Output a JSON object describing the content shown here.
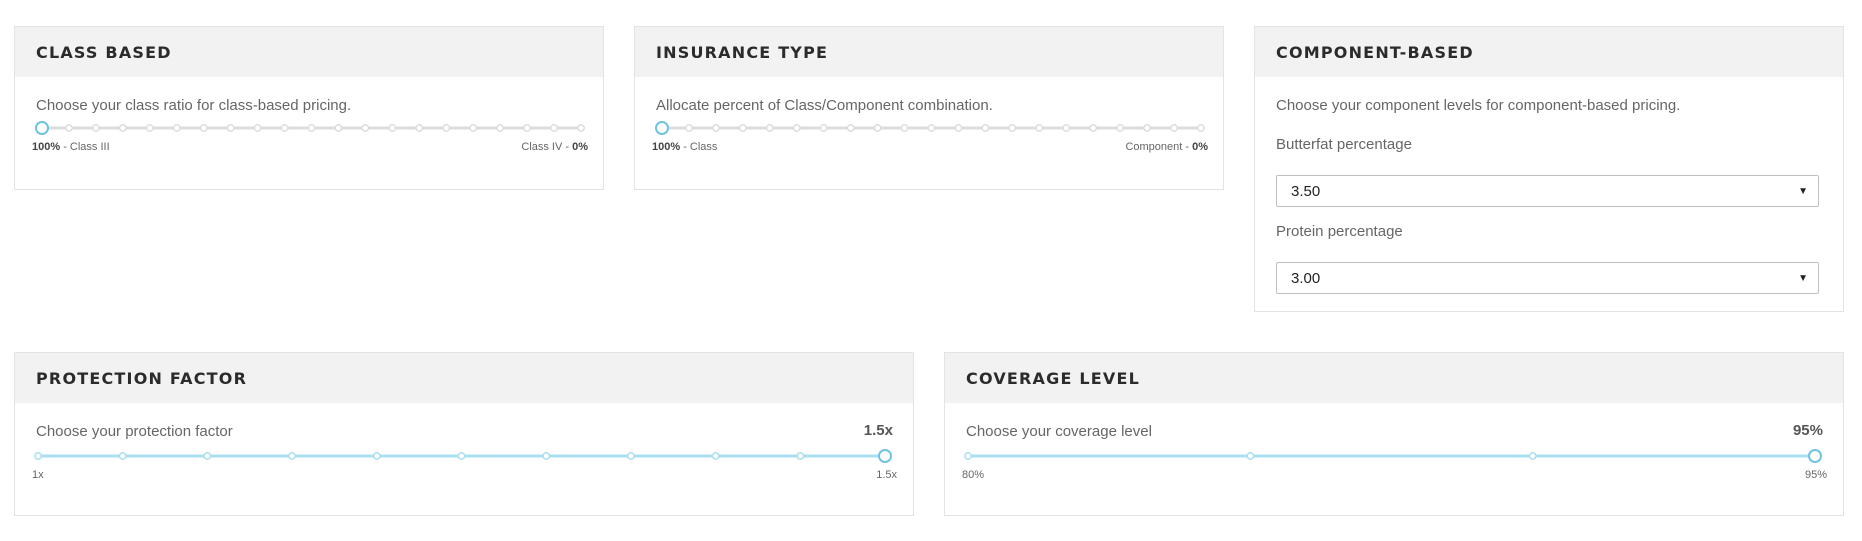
{
  "colors": {
    "track_inactive": "#dcdcdc",
    "track_active": "#a9dff0",
    "handle_border": "#6fc3e0"
  },
  "class_based": {
    "title": "CLASS BASED",
    "description": "Choose your class ratio for class-based pricing.",
    "slider": {
      "left_label_bold": "100%",
      "left_label_rest": " - Class III",
      "right_label_rest": "Class IV - ",
      "right_label_bold": "0%",
      "steps": 20,
      "position": 0
    }
  },
  "insurance_type": {
    "title": "INSURANCE TYPE",
    "description": "Allocate percent of Class/Component combination.",
    "slider": {
      "left_label_bold": "100%",
      "left_label_rest": " - Class",
      "right_label_rest": "Component - ",
      "right_label_bold": "0%",
      "steps": 20,
      "position": 0
    }
  },
  "component_based": {
    "title": "COMPONENT-BASED",
    "description": "Choose your component levels for component-based pricing.",
    "butterfat": {
      "label": "Butterfat percentage",
      "value": "3.50"
    },
    "protein": {
      "label": "Protein percentage",
      "value": "3.00"
    }
  },
  "protection_factor": {
    "title": "PROTECTION FACTOR",
    "description": "Choose your protection factor",
    "value": "1.5x",
    "slider": {
      "min_label": "1x",
      "max_label": "1.5x",
      "steps": 10,
      "position": 10
    }
  },
  "coverage_level": {
    "title": "COVERAGE LEVEL",
    "description": "Choose your coverage level",
    "value": "95%",
    "slider": {
      "min_label": "80%",
      "max_label": "95%",
      "steps": 3,
      "position": 3
    }
  }
}
